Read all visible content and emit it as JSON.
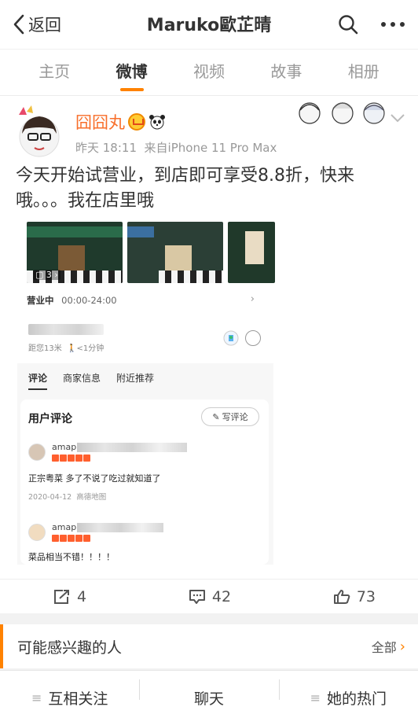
{
  "nav": {
    "back_label": "返回",
    "title": "Maruko歐芷晴",
    "search_icon": "search-icon",
    "more_icon": "more-icon"
  },
  "tabs": [
    {
      "label": "主页",
      "active": false
    },
    {
      "label": "微博",
      "active": true
    },
    {
      "label": "视频",
      "active": false
    },
    {
      "label": "故事",
      "active": false
    },
    {
      "label": "相册",
      "active": false
    }
  ],
  "post": {
    "author": "囧囧丸",
    "time": "昨天 18:11",
    "source": "来自iPhone 11 Pro Max",
    "text": "今天开始试营业，到店即可享受8.8折，快来哦。。。我在店里哦",
    "embed": {
      "photo_count": "3",
      "hours_label": "营业中",
      "hours_value": "00:00-24:00",
      "distance": "距您13米",
      "walk": "<1分钟",
      "tabs": [
        "评论",
        "商家信息",
        "附近推荐"
      ],
      "reviews_title": "用户评论",
      "write_review": "写评论",
      "reviews": [
        {
          "name": "amap",
          "text": "正宗粤菜 多了不说了吃过就知道了",
          "date": "2020-04-12",
          "source": "高德地图"
        },
        {
          "name": "amap",
          "text": "菜品相当不错！！！！",
          "date": "",
          "source": ""
        }
      ]
    },
    "stats": {
      "reposts": "4",
      "comments": "42",
      "likes": "73"
    }
  },
  "interest": {
    "label": "可能感兴趣的人",
    "all": "全部"
  },
  "bottom_bar": {
    "follow": "互相关注",
    "chat": "聊天",
    "hot": "她的热门"
  },
  "colors": {
    "accent": "#ff8200",
    "username": "#f86e2a"
  }
}
